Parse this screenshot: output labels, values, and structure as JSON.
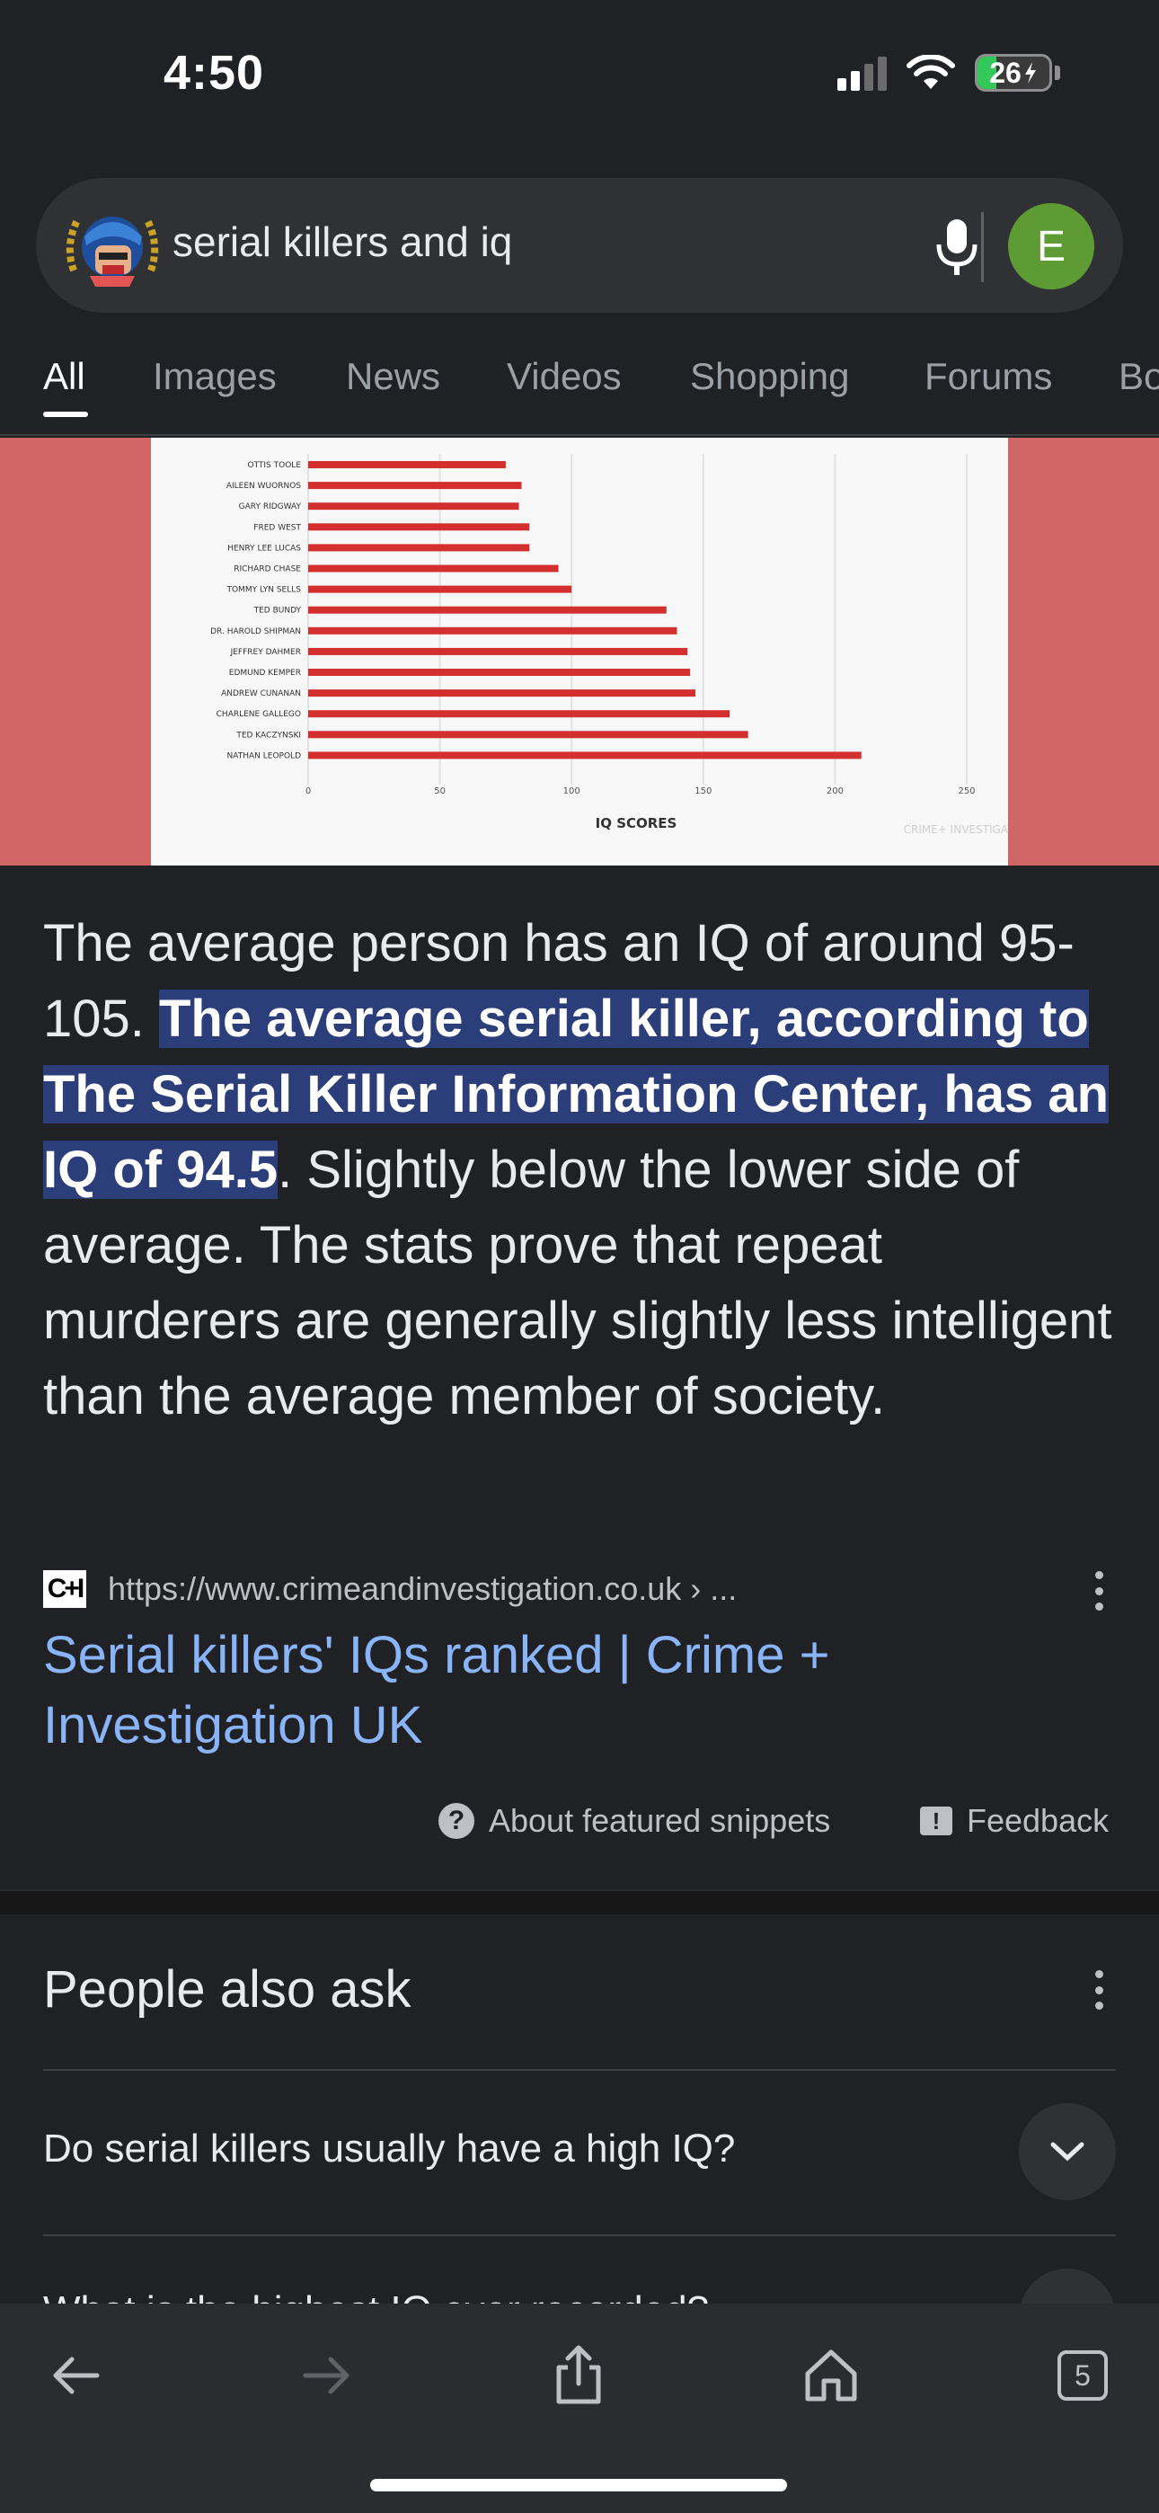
{
  "status_bar": {
    "time": "4:50",
    "battery": "26",
    "battery_level_pct": 26
  },
  "search": {
    "query": "serial killers and iq",
    "avatar_letter": "E"
  },
  "tabs": [
    {
      "label": "All",
      "active": true
    },
    {
      "label": "Images"
    },
    {
      "label": "News"
    },
    {
      "label": "Videos"
    },
    {
      "label": "Shopping"
    },
    {
      "label": "Forums"
    },
    {
      "label": "Bo"
    }
  ],
  "chart_data": {
    "type": "bar",
    "orientation": "horizontal",
    "categories": [
      "OTTIS TOOLE",
      "AILEEN WUORNOS",
      "GARY RIDGWAY",
      "FRED WEST",
      "HENRY LEE LUCAS",
      "RICHARD CHASE",
      "TOMMY LYN SELLS",
      "TED BUNDY",
      "DR. HAROLD SHIPMAN",
      "JEFFREY DAHMER",
      "EDMUND KEMPER",
      "ANDREW CUNANAN",
      "CHARLENE GALLEGO",
      "TED KACZYNSKI",
      "NATHAN LEOPOLD"
    ],
    "values": [
      75,
      81,
      80,
      84,
      84,
      95,
      100,
      136,
      140,
      144,
      145,
      147,
      160,
      167,
      210
    ],
    "xlabel": "IQ SCORES",
    "xticks": [
      "0",
      "50",
      "100",
      "150",
      "200",
      "250"
    ],
    "xlim": [
      0,
      250
    ],
    "bar_color": "#d32f2f",
    "watermark": "CRIME+ INVESTIGATION",
    "grid": true
  },
  "snippet": {
    "before": "The average person has an IQ of around 95-105. ",
    "highlight": "The average serial killer, according to The Serial Killer Information Center, has an IQ of 94.5",
    "after": ". Slightly below the lower side of average. The stats prove that repeat murderers are generally slightly less intelligent than the average member of society."
  },
  "source": {
    "favicon_text": "C+I",
    "url": "https://www.crimeandinvestigation.co.uk › ...",
    "title": "Serial killers' IQs ranked | Crime + Investigation UK"
  },
  "footer_links": {
    "about": "About featured snippets",
    "feedback": "Feedback"
  },
  "paa": {
    "title": "People also ask",
    "questions": [
      "Do serial killers usually have a high IQ?",
      "What is the highest IQ ever recorded?"
    ]
  },
  "toolbar": {
    "tab_count": "5"
  }
}
